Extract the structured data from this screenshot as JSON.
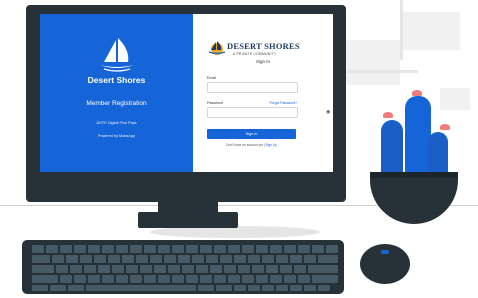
{
  "left_panel": {
    "brand": "Desert Shores",
    "heading": "Member Registration",
    "line1": "DDTE Digital Pool Pass",
    "line2": "Powered by MobsApp"
  },
  "form": {
    "brand": "DESERT SHORES",
    "brand_sub": "A PRIVATE COMMUNITY",
    "title": "Sign In",
    "email_label": "Email",
    "password_label": "Password",
    "forgot_link": "Forgot Password?",
    "signin_button": "Sign In",
    "signup_prompt": "Don't have an account yet",
    "signup_link": "Sign Up"
  },
  "colors": {
    "brand_blue": "#1565d8",
    "device_dark": "#263238"
  },
  "icons": {
    "logo": "sailboat-logo-icon",
    "password_toggle": "eye-icon"
  }
}
